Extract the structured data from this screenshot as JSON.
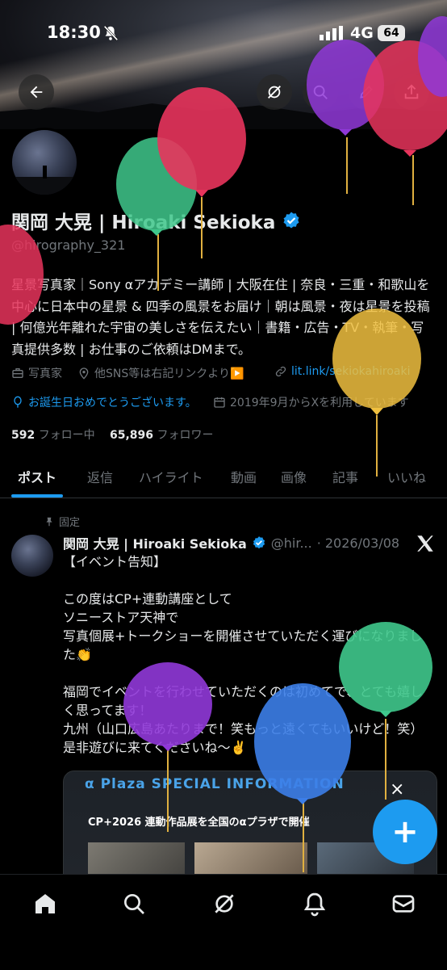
{
  "status": {
    "time": "18:30",
    "network": "4G",
    "battery": "64"
  },
  "profile": {
    "name": "関岡 大晃 | Hiroaki Sekioka",
    "handle": "@hirography_321",
    "bio": "星景写真家｜Sony αアカデミー講師 | 大阪在住 | 奈良・三重・和歌山を中心に日本中の星景 & 四季の風景をお届け｜朝は風景・夜は星景を投稿 | 何億光年離れた宇宙の美しさを伝えたい｜書籍・広告・TV・執筆・写真提供多数 | お仕事のご依頼はDMまで。",
    "category": "写真家",
    "location": "他SNS等は右記リンクより▶️",
    "link": "lit.link/sekiokahiroaki",
    "birthday": "お誕生日おめでとうございます。",
    "joined": "2019年9月からXを利用しています",
    "following_count": "592",
    "following_label": "フォロー中",
    "followers_count": "65,896",
    "followers_label": "フォロワー"
  },
  "tabs": [
    "ポスト",
    "返信",
    "ハイライト",
    "動画",
    "画像",
    "記事",
    "いいね"
  ],
  "pinned_label": "固定",
  "post": {
    "author": "関岡 大晃 | Hiroaki Sekioka",
    "handle": "@hir...",
    "date": "· 2026/03/08",
    "text": "【イベント告知】\n\nこの度はCP+連動講座として\nソニーストア天神で\n写真個展+トークショーを開催させていただく運びになりました👏\n\n福岡でイベントを行わせていただくのは初めてで、とても嬉しく思ってます！\n九州（山口広島あたりまで！笑もっと遠くてもいいけど！笑）是非遊びに来てくださいね～✌️"
  },
  "card": {
    "brand": "α Plaza SPECIAL INFORMATION",
    "headline": "CP+2026 連動作品展を全国のαプラザで開催",
    "close": "×"
  },
  "fab": {
    "label": "+"
  },
  "colors": {
    "accent": "#1d9bf0",
    "verified": "#1d9bf0",
    "background": "#000000"
  },
  "icons": [
    "back-icon",
    "grok-icon",
    "search-icon",
    "edit-icon",
    "share-icon",
    "verified-icon",
    "briefcase-icon",
    "location-icon",
    "link-icon",
    "balloon-icon",
    "calendar-icon",
    "pin-icon",
    "x-logo-icon",
    "home-icon",
    "grok-icon",
    "bell-icon",
    "mail-icon"
  ]
}
